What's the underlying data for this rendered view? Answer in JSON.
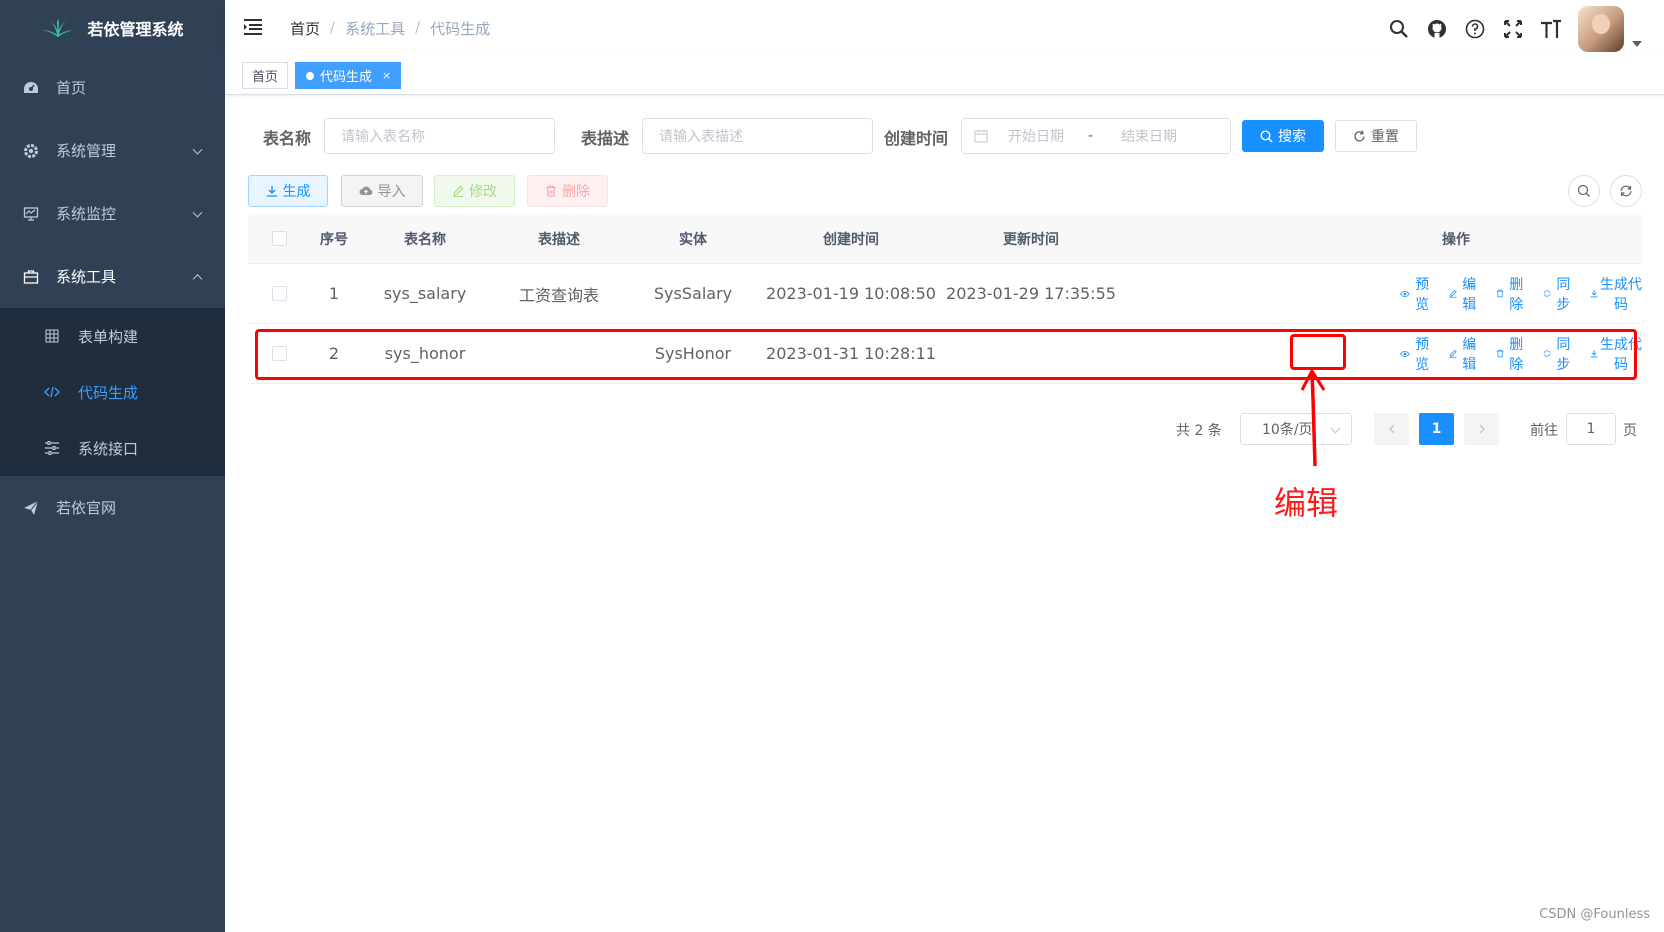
{
  "app": {
    "title": "若依管理系统"
  },
  "sidebar": {
    "items": [
      {
        "label": "首页",
        "icon": "dashboard-icon"
      },
      {
        "label": "系统管理",
        "icon": "gear-icon"
      },
      {
        "label": "系统监控",
        "icon": "monitor-icon"
      },
      {
        "label": "系统工具",
        "icon": "toolbox-icon"
      },
      {
        "label": "若依官网",
        "icon": "send-icon"
      }
    ],
    "tools_submenu": [
      {
        "label": "表单构建",
        "icon": "table-icon"
      },
      {
        "label": "代码生成",
        "icon": "code-icon"
      },
      {
        "label": "系统接口",
        "icon": "sliders-icon"
      }
    ]
  },
  "navbar": {
    "breadcrumb": [
      "首页",
      "系统工具",
      "代码生成"
    ],
    "separator": "/"
  },
  "tags": {
    "home": "首页",
    "active": "代码生成",
    "close": "×"
  },
  "search": {
    "table_name_label": "表名称",
    "table_name_placeholder": "请输入表名称",
    "table_desc_label": "表描述",
    "table_desc_placeholder": "请输入表描述",
    "created_label": "创建时间",
    "start_placeholder": "开始日期",
    "range_sep": "-",
    "end_placeholder": "结束日期",
    "search_button": "搜索",
    "reset_button": "重置"
  },
  "toolbar": {
    "generate": "生成",
    "import": "导入",
    "edit": "修改",
    "delete": "删除"
  },
  "table": {
    "headers": [
      "序号",
      "表名称",
      "表描述",
      "实体",
      "创建时间",
      "更新时间",
      "操作"
    ],
    "rows": [
      {
        "no": "1",
        "name": "sys_salary",
        "desc": "工资查询表",
        "entity": "SysSalary",
        "created": "2023-01-19 10:08:50",
        "updated": "2023-01-29 17:35:55"
      },
      {
        "no": "2",
        "name": "sys_honor",
        "desc": "",
        "entity": "SysHonor",
        "created": "2023-01-31 10:28:11",
        "updated": ""
      }
    ],
    "ops": {
      "preview": "预览",
      "edit": "编辑",
      "delete": "删除",
      "sync": "同步",
      "gen": "生成代码"
    }
  },
  "pagination": {
    "total": "共 2 条",
    "page_size": "10条/页",
    "current_page": "1",
    "goto_label": "前往",
    "goto_value": "1",
    "goto_unit": "页"
  },
  "annotation": {
    "text": "编辑"
  },
  "watermark": "CSDN @Founless",
  "colors": {
    "accent": "#1890ff",
    "sidebar": "#304156",
    "annotation": "#ff0000"
  }
}
